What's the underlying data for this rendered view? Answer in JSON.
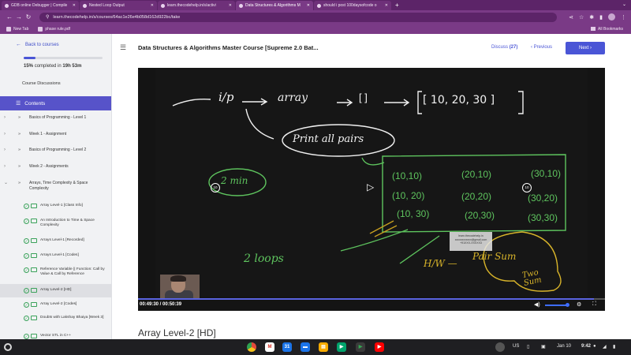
{
  "browser": {
    "tabs": [
      {
        "title": "GDB online Debugger | Compile",
        "active": false
      },
      {
        "title": "Nested Loop Output",
        "active": false
      },
      {
        "title": "learn.thecodehelp.in/s/activi",
        "active": false
      },
      {
        "title": "Data Structures & Algorithms M",
        "active": true
      },
      {
        "title": "should i post 100daysofcode o",
        "active": false
      }
    ],
    "url": "learn.thecodehelp.in/s/courses/64ac1e26e4b058d162d922bc/take",
    "bookmarks": [
      "New Tab",
      "phase rule.pdf"
    ],
    "all_bookmarks": "All Bookmarks"
  },
  "sidebar": {
    "back": "Back to courses",
    "progress_percent": 15,
    "progress_pct_label": "15%",
    "progress_rest": "completed in",
    "progress_time": "19h 53m",
    "course_discussions": "Course Discussions",
    "contents": "Contents",
    "modules": [
      "Basics of Programming - Level 1",
      "Week 1 - Assignment",
      "Basics of Programming - Level 2",
      "Week 2 - Assignments",
      "Arrays, Time Complexity & Space Complexity"
    ],
    "lessons": [
      "Array Level-1 [Class Info]",
      "An Introduction to Time & Space Complexity",
      "Arrays Level-1 [Recorded]",
      "Arrays Level-1 [Codes]",
      "Reference Variable || Function: Call by Value & Call by Reference",
      "Array Level-2 [HD]",
      "Array Level-2 [Codes]",
      "Doubts with Lakshay Bhaiya [Week 3]",
      "Vector STL in C++"
    ]
  },
  "header": {
    "course_title": "Data Structures & Algorithms Master Course [Supreme 2.0 Bat...",
    "discuss_label": "Discuss",
    "discuss_count": "(27)",
    "previous": "Previous",
    "next": "Next"
  },
  "video": {
    "time": "00:49:30 / 00:50:39",
    "progress": 0.977,
    "volume": 0.85,
    "skip_back": "10",
    "skip_forward": "10",
    "watermark": [
      "learn.thecodehelp.in",
      "xxxxxxxxxxxx@gmail.com",
      "+91XXX-XXXXX3"
    ],
    "board": {
      "ip": "i/p",
      "array": "array",
      "brackets": "[ ]",
      "array_values": "[ 10, 20, 30 ]",
      "print_all_pairs": "Print all pairs",
      "min": "2 min",
      "pairs": [
        "(10,10)",
        "(20,10)",
        "(30,10)",
        "(10, 20)",
        "(20,20)",
        "(30,20)",
        "(10, 30)",
        "(20,30)",
        "(30,30)"
      ],
      "loops": "2 loops",
      "hw": "H/W —",
      "pair_sum": "Pair Sum",
      "two_sum": "Two Sum"
    }
  },
  "lecture_title": "Array Level-2 [HD]",
  "shelf": {
    "locale": "US",
    "date": "Jan 10",
    "time": "9:42"
  }
}
